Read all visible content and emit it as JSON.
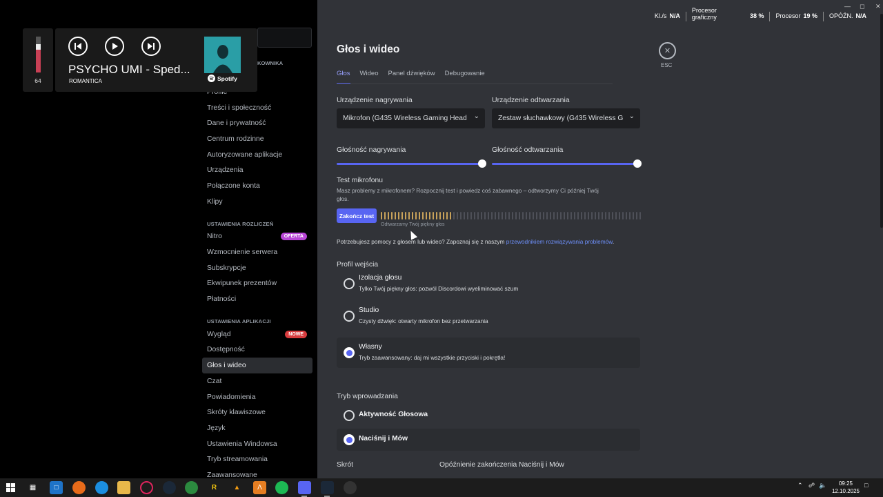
{
  "overlay": {
    "volume": "64",
    "volume_level": 0.64,
    "track_title": "PSYCHO UMI - Sped...",
    "track_artist": "ROMANTICA",
    "spotify_label": "Spotify",
    "cut_label": "KOWNIKA"
  },
  "stats": {
    "kls_label": "Kl./s",
    "kls_value": "N/A",
    "gpu_label_1": "Procesor",
    "gpu_label_2": "graficzny",
    "gpu_value": "38 %",
    "cpu_label": "Procesor",
    "cpu_value": "19 %",
    "lag_label": "OPÓŹN.",
    "lag_value": "N/A"
  },
  "sidebar": {
    "user_items": [
      "Profile",
      "Treści i społeczność",
      "Dane i prywatność",
      "Centrum rodzinne",
      "Autoryzowane aplikacje",
      "Urządzenia",
      "Połączone konta",
      "Klipy"
    ],
    "billing_header": "USTAWIENIA ROZLICZEŃ",
    "billing_items": [
      {
        "label": "Nitro",
        "badge": "OFERTA"
      },
      {
        "label": "Wzmocnienie serwera"
      },
      {
        "label": "Subskrypcje"
      },
      {
        "label": "Ekwipunek prezentów"
      },
      {
        "label": "Płatności"
      }
    ],
    "app_header": "USTAWIENIA APLIKACJI",
    "app_items": [
      {
        "label": "Wygląd",
        "badge": "NOWE"
      },
      {
        "label": "Dostępność"
      },
      {
        "label": "Głos i wideo",
        "active": true
      },
      {
        "label": "Czat"
      },
      {
        "label": "Powiadomienia"
      },
      {
        "label": "Skróty klawiszowe"
      },
      {
        "label": "Język"
      },
      {
        "label": "Ustawienia Windowsa"
      },
      {
        "label": "Tryb streamowania"
      },
      {
        "label": "Zaawansowane"
      }
    ]
  },
  "main": {
    "title": "Głos i wideo",
    "tabs": [
      "Głos",
      "Wideo",
      "Panel dźwięków",
      "Debugowanie"
    ],
    "input_device_label": "Urządzenie nagrywania",
    "input_device_value": "Mikrofon (G435 Wireless Gaming Head",
    "output_device_label": "Urządzenie odtwarzania",
    "output_device_value": "Zestaw słuchawkowy (G435 Wireless G",
    "input_volume_label": "Głośność nagrywania",
    "input_volume_level": 1.0,
    "output_volume_label": "Głośność odtwarzania",
    "output_volume_level": 1.0,
    "mic_test_title": "Test mikrofonu",
    "mic_test_desc": "Masz problemy z mikrofonem? Rozpocznij test i powiedz coś zabawnego – odtworzymy Ci później Twój głos.",
    "end_test_button": "Zakończ test",
    "meter_caption": "Odtwarzamy Twój piękny głos",
    "meter_level": 0.27,
    "help_text": "Potrzebujesz pomocy z głosem lub wideo? Zapoznaj się z naszym ",
    "help_link": "przewodnikiem rozwiązywania problemów",
    "help_end": ".",
    "input_profile_title": "Profil wejścia",
    "profiles": [
      {
        "title": "Izolacja głosu",
        "desc": "Tylko Twój piękny głos: pozwól Discordowi wyeliminować szum",
        "selected": false
      },
      {
        "title": "Studio",
        "desc": "Czysty dźwięk: otwarty mikrofon bez przetwarzania",
        "selected": false
      },
      {
        "title": "Własny",
        "desc": "Tryb zaawansowany: daj mi wszystkie przyciski i pokrętła!",
        "selected": true
      }
    ],
    "input_mode_title": "Tryb wprowadzania",
    "modes": [
      {
        "title": "Aktywność Głosowa",
        "selected": false
      },
      {
        "title": "Naciśnij i Mów",
        "selected": true
      }
    ],
    "shortcut_label": "Skrót",
    "ptt_delay_label": "Opóźnienie zakończenia Naciśnij i Mów",
    "close_label": "ESC"
  },
  "taskbar": {
    "time": "09:25",
    "date": "12.10.2025"
  }
}
